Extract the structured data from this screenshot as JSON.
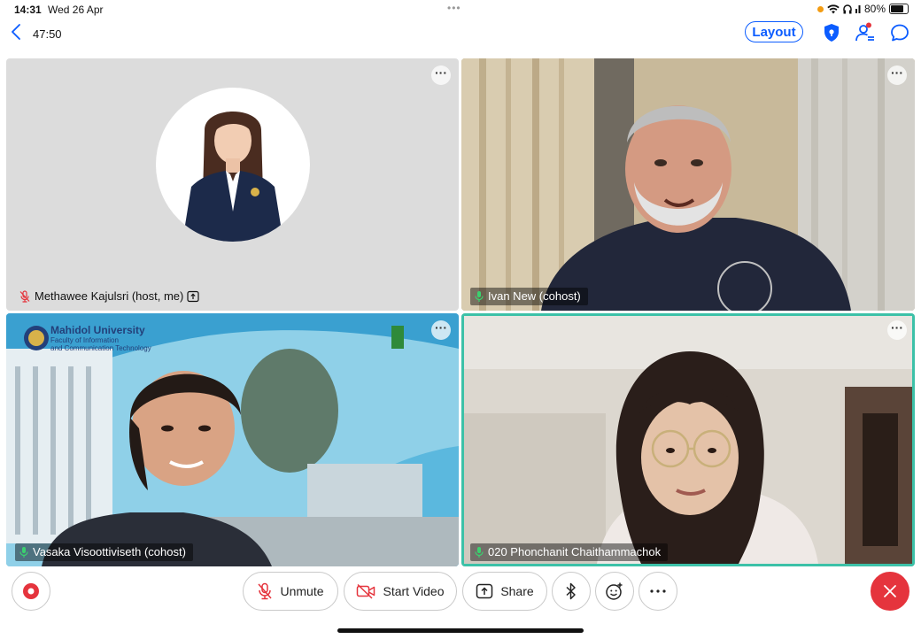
{
  "status": {
    "time": "14:31",
    "date": "Wed 26 Apr",
    "battery": "80%"
  },
  "header": {
    "timer": "47:50",
    "layout_label": "Layout"
  },
  "participants": [
    {
      "name": "Methawee Kajulsri (host, me)",
      "muted": true
    },
    {
      "name": "Ivan New (cohost)",
      "muted": false
    },
    {
      "name": "Vasaka Visoottiviseth (cohost)",
      "muted": false,
      "background_title": "Mahidol University",
      "background_sub1": "Faculty of Information",
      "background_sub2": "and Communication Technology"
    },
    {
      "name": "020 Phonchanit Chaithammachok",
      "muted": false,
      "active_speaker": true
    }
  ],
  "toolbar": {
    "unmute_label": "Unmute",
    "start_video_label": "Start Video",
    "share_label": "Share"
  },
  "colors": {
    "accent": "#0b5cff",
    "active_speaker": "#3cc1a8",
    "leave": "#e5343d",
    "record": "#e5343d"
  }
}
